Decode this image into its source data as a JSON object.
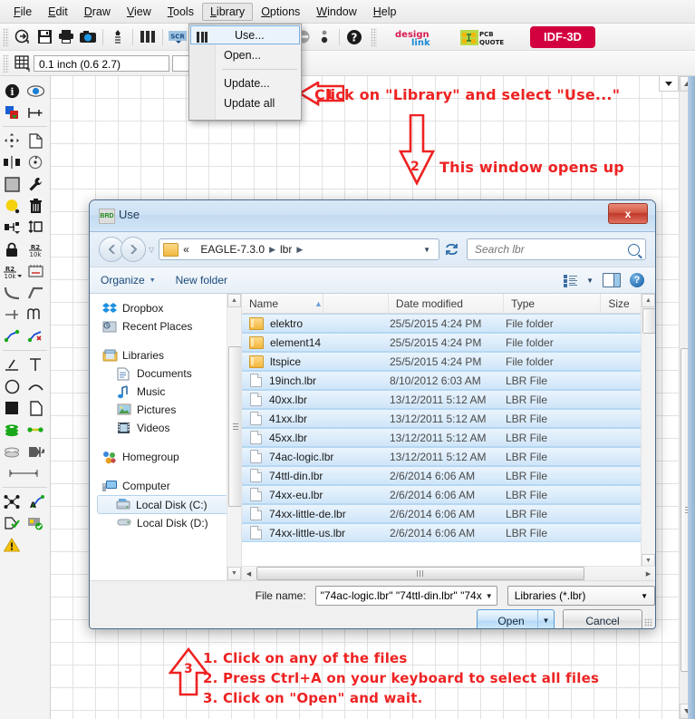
{
  "app": {
    "menubar": [
      "File",
      "Edit",
      "Draw",
      "View",
      "Tools",
      "Library",
      "Options",
      "Window",
      "Help"
    ],
    "active_menu": "Library",
    "coordinate_display": "0.1 inch (0.6 2.7)",
    "brand_buttons": [
      {
        "name": "design-link",
        "line1": "design",
        "line2": "link"
      },
      {
        "name": "pcb-quote",
        "line1": "PCB",
        "line2": "QUOTE"
      },
      {
        "name": "idf-3d",
        "label": "IDF-3D"
      }
    ]
  },
  "library_menu": {
    "items": [
      {
        "label": "Use...",
        "highlighted": true,
        "has_icon": true
      },
      {
        "label": "Open...",
        "highlighted": false,
        "has_icon": false
      },
      {
        "label": "Update...",
        "highlighted": false,
        "has_icon": false
      },
      {
        "label": "Update all",
        "highlighted": false,
        "has_icon": false
      }
    ]
  },
  "annotations": {
    "step1": {
      "number": "1",
      "text": "Click on \"Library\" and select \"Use...\""
    },
    "step2": {
      "number": "2",
      "text": "This window opens up"
    },
    "step3": {
      "number": "3",
      "lines": [
        "1. Click on any of the files",
        "2. Press Ctrl+A on your keyboard to select all files",
        "3. Click on \"Open\" and wait."
      ]
    }
  },
  "dialog": {
    "title": "Use",
    "icon_label": "BRD",
    "close_label": "x",
    "breadcrumb": [
      "EAGLE-7.3.0",
      "lbr"
    ],
    "breadcrumb_prefix": "«",
    "search_placeholder": "Search lbr",
    "commands": {
      "organize": "Organize",
      "new_folder": "New folder"
    },
    "nav_pane": [
      {
        "label": "Dropbox",
        "icon": "dropbox-icon",
        "indent": false,
        "selected": false
      },
      {
        "label": "Recent Places",
        "icon": "recent-places-icon",
        "indent": false,
        "selected": false
      },
      {
        "gap": true
      },
      {
        "label": "Libraries",
        "icon": "libraries-icon",
        "indent": false,
        "selected": false
      },
      {
        "label": "Documents",
        "icon": "documents-icon",
        "indent": true,
        "selected": false
      },
      {
        "label": "Music",
        "icon": "music-icon",
        "indent": true,
        "selected": false
      },
      {
        "label": "Pictures",
        "icon": "pictures-icon",
        "indent": true,
        "selected": false
      },
      {
        "label": "Videos",
        "icon": "videos-icon",
        "indent": true,
        "selected": false
      },
      {
        "gap": true
      },
      {
        "label": "Homegroup",
        "icon": "homegroup-icon",
        "indent": false,
        "selected": false
      },
      {
        "gap": true
      },
      {
        "label": "Computer",
        "icon": "computer-icon",
        "indent": false,
        "selected": false
      },
      {
        "label": "Local Disk (C:)",
        "icon": "local-disk-c-icon",
        "indent": true,
        "selected": true
      },
      {
        "label": "Local Disk (D:)",
        "icon": "local-disk-d-icon",
        "indent": true,
        "selected": false
      }
    ],
    "columns": [
      "Name",
      "Date modified",
      "Type",
      "Size"
    ],
    "files": [
      {
        "name": "elektro",
        "date": "25/5/2015 4:24 PM",
        "type": "File folder",
        "size": "",
        "kind": "folder",
        "selected": true
      },
      {
        "name": "element14",
        "date": "25/5/2015 4:24 PM",
        "type": "File folder",
        "size": "",
        "kind": "folder",
        "selected": true
      },
      {
        "name": "ltspice",
        "date": "25/5/2015 4:24 PM",
        "type": "File folder",
        "size": "",
        "kind": "folder",
        "selected": true
      },
      {
        "name": "19inch.lbr",
        "date": "8/10/2012 6:03 AM",
        "type": "LBR File",
        "size": "",
        "kind": "file",
        "selected": true
      },
      {
        "name": "40xx.lbr",
        "date": "13/12/2011 5:12 AM",
        "type": "LBR File",
        "size": "",
        "kind": "file",
        "selected": true
      },
      {
        "name": "41xx.lbr",
        "date": "13/12/2011 5:12 AM",
        "type": "LBR File",
        "size": "",
        "kind": "file",
        "selected": true
      },
      {
        "name": "45xx.lbr",
        "date": "13/12/2011 5:12 AM",
        "type": "LBR File",
        "size": "",
        "kind": "file",
        "selected": true
      },
      {
        "name": "74ac-logic.lbr",
        "date": "13/12/2011 5:12 AM",
        "type": "LBR File",
        "size": "",
        "kind": "file",
        "selected": true
      },
      {
        "name": "74ttl-din.lbr",
        "date": "2/6/2014 6:06 AM",
        "type": "LBR File",
        "size": "",
        "kind": "file",
        "selected": true
      },
      {
        "name": "74xx-eu.lbr",
        "date": "2/6/2014 6:06 AM",
        "type": "LBR File",
        "size": "",
        "kind": "file",
        "selected": true
      },
      {
        "name": "74xx-little-de.lbr",
        "date": "2/6/2014 6:06 AM",
        "type": "LBR File",
        "size": "",
        "kind": "file",
        "selected": true
      },
      {
        "name": "74xx-little-us.lbr",
        "date": "2/6/2014 6:06 AM",
        "type": "LBR File",
        "size": "",
        "kind": "file",
        "selected": true
      }
    ],
    "footer": {
      "file_name_label": "File name:",
      "file_name_value": "\"74ac-logic.lbr\" \"74ttl-din.lbr\" \"74x",
      "filter_value": "Libraries (*.lbr)",
      "open_label": "Open",
      "cancel_label": "Cancel"
    }
  }
}
